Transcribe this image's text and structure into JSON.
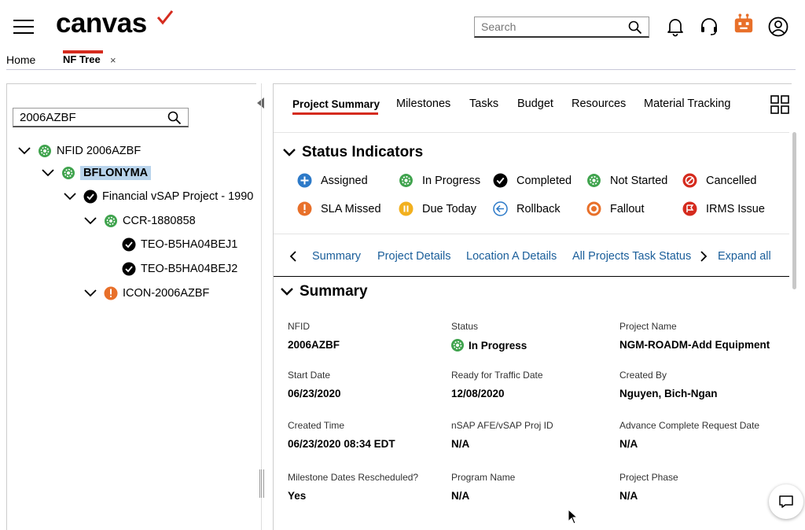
{
  "header": {
    "logo_text": "canvas",
    "search_placeholder": "Search"
  },
  "tabs": {
    "home": "Home",
    "active": "NF Tree",
    "close": "×"
  },
  "tree": {
    "search_value": "2006AZBF",
    "nodes": [
      {
        "label": "NFID 2006AZBF",
        "status": "gear"
      },
      {
        "label": "BFLONYMA",
        "status": "gear",
        "selected": true
      },
      {
        "label": "Financial vSAP Project - 1990",
        "status": "check"
      },
      {
        "label": "CCR-1880858",
        "status": "gear"
      },
      {
        "label": "TEO-B5HA04BEJ1",
        "status": "check"
      },
      {
        "label": "TEO-B5HA04BEJ2",
        "status": "check"
      },
      {
        "label": "ICON-2006AZBF",
        "status": "alert"
      }
    ]
  },
  "project_tabs": [
    "Project Summary",
    "Milestones",
    "Tasks",
    "Budget",
    "Resources",
    "Material Tracking"
  ],
  "status_indicators": {
    "title": "Status Indicators",
    "items": [
      {
        "label": "Assigned",
        "icon": "plus-circle-icon",
        "color": "#2d7ac8"
      },
      {
        "label": "In Progress",
        "icon": "gear-icon",
        "color": "#3fa34d"
      },
      {
        "label": "Completed",
        "icon": "check-circle-icon",
        "color": "#000000"
      },
      {
        "label": "Not Started",
        "icon": "gear-icon",
        "color": "#3fa34d"
      },
      {
        "label": "Cancelled",
        "icon": "cancel-circle-icon",
        "color": "#d52b1e"
      },
      {
        "label": "SLA Missed",
        "icon": "alert-circle-icon",
        "color": "#e8702a"
      },
      {
        "label": "Due Today",
        "icon": "pause-circle-icon",
        "color": "#f2b01e"
      },
      {
        "label": "Rollback",
        "icon": "back-arrow-circle-icon",
        "color": "#2d7ac8"
      },
      {
        "label": "Fallout",
        "icon": "dot-circle-icon",
        "color": "#e8702a"
      },
      {
        "label": "IRMS Issue",
        "icon": "flag-circle-icon",
        "color": "#d52b1e"
      }
    ]
  },
  "section_links": [
    "Summary",
    "Project Details",
    "Location A Details",
    "All Projects Task Status",
    "Expand all"
  ],
  "summary": {
    "title": "Summary",
    "fields": [
      {
        "label": "NFID",
        "value": "2006AZBF"
      },
      {
        "label": "Status",
        "value": "In Progress"
      },
      {
        "label": "Project Name",
        "value": "NGM-ROADM-Add Equipment"
      },
      {
        "label": "Start Date",
        "value": "06/23/2020"
      },
      {
        "label": "Ready for Traffic Date",
        "value": "12/08/2020"
      },
      {
        "label": "Created By",
        "value": "Nguyen, Bich-Ngan"
      },
      {
        "label": "Created Time",
        "value": "06/23/2020 08:34 EDT"
      },
      {
        "label": "nSAP AFE/vSAP Proj ID",
        "value": "N/A"
      },
      {
        "label": "Advance Complete Request Date",
        "value": "N/A"
      },
      {
        "label": "Milestone Dates Rescheduled?",
        "value": "Yes"
      },
      {
        "label": "Program Name",
        "value": "N/A"
      },
      {
        "label": "Project Phase",
        "value": "N/A"
      }
    ]
  },
  "colors": {
    "brand_red": "#d52b1e",
    "link_blue": "#1a5e9a",
    "selected_bg": "#b9d4ec"
  }
}
